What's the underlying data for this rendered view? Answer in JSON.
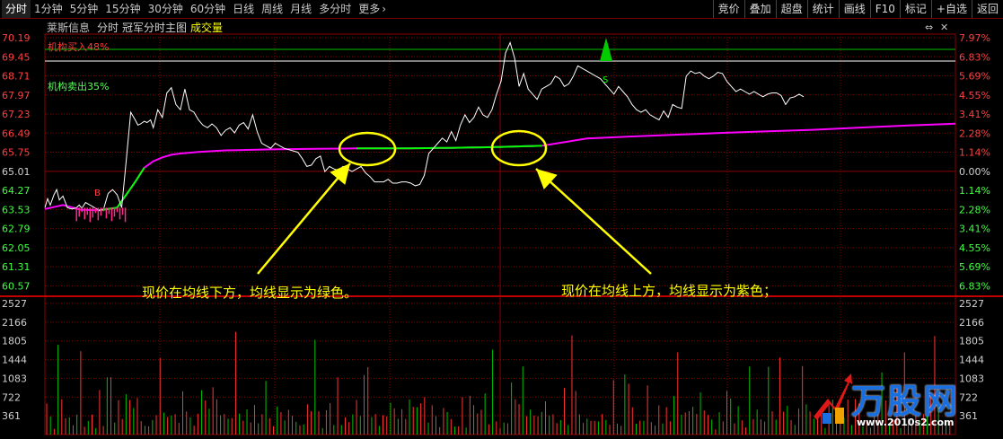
{
  "toolbar": {
    "tabs": [
      "分时",
      "1分钟",
      "5分钟",
      "15分钟",
      "30分钟",
      "60分钟",
      "日线",
      "周线",
      "月线",
      "多分时",
      "更多"
    ],
    "more_arrow": "›",
    "right_buttons": [
      "竞价",
      "叠加",
      "超盘",
      "统计",
      "画线",
      "F10",
      "标记",
      "+自选",
      "返回"
    ]
  },
  "info": {
    "stock_name": "莱斯信息",
    "mode": "分时",
    "indicator": "冠军分时主图",
    "volume_label": "成交量"
  },
  "indicators": {
    "buy": "机构买入48%",
    "sell": "机构卖出35%",
    "b_marker": "B",
    "s_marker": "S"
  },
  "annotations": {
    "left": "现价在均线下方，均线显示为绿色。",
    "right": "现价在均线上方，均线显示为紫色；"
  },
  "logo": {
    "brand": "万股网",
    "url": "www.2010s2.com"
  },
  "colors": {
    "background": "#000000",
    "grid": "#8b0000",
    "price_line": "#ffffff",
    "avg_above": "#ff00ff",
    "avg_below": "#00ff00",
    "up": "#ff3333",
    "down": "#00c000",
    "annotation": "#ffff00"
  },
  "chart_data": {
    "type": "line",
    "price_axis_labels": [
      "70.19",
      "69.45",
      "68.71",
      "67.97",
      "67.23",
      "66.49",
      "65.75",
      "65.01",
      "64.27",
      "63.53",
      "62.79",
      "62.05",
      "61.31",
      "60.57"
    ],
    "percent_axis_labels": [
      "7.97%",
      "6.83%",
      "5.69%",
      "4.55%",
      "3.41%",
      "2.28%",
      "1.14%",
      "0.00%",
      "1.14%",
      "2.28%",
      "3.41%",
      "4.55%",
      "5.69%",
      "6.83%"
    ],
    "volume_axis_labels": [
      "2527",
      "2166",
      "1805",
      "1444",
      "1083",
      "722",
      "361"
    ],
    "prev_close": 65.01,
    "ylim": [
      60.2,
      70.19
    ],
    "price_series": {
      "x": [
        0,
        3,
        6,
        10,
        13,
        16,
        20,
        25,
        30,
        35,
        38,
        41,
        45,
        50,
        55,
        60,
        65,
        70,
        75,
        80,
        85,
        90,
        95,
        100,
        103,
        106,
        110,
        113,
        117,
        120,
        125,
        130,
        135,
        140,
        145,
        150,
        155,
        160,
        165,
        170,
        175,
        180,
        185,
        190,
        195,
        200,
        205,
        210,
        215,
        220,
        225,
        230,
        235,
        240,
        245,
        250,
        255,
        260,
        265,
        270,
        275,
        280,
        285,
        290,
        295,
        300,
        305,
        310,
        315,
        320,
        325,
        330,
        335,
        340,
        345,
        350,
        355,
        360,
        365,
        370,
        375,
        380,
        385,
        390,
        395,
        400,
        405,
        410,
        415,
        420,
        425,
        430,
        435,
        440,
        445,
        450,
        455,
        460,
        465,
        470,
        475,
        480,
        485,
        490,
        495,
        500,
        505,
        510,
        515,
        520,
        525,
        530,
        535,
        540,
        545,
        550,
        555,
        560,
        565,
        570,
        575,
        580,
        585,
        590,
        595,
        600,
        605,
        610,
        615,
        620,
        625,
        630,
        635,
        640,
        645,
        650,
        655,
        660,
        665,
        670,
        675,
        680,
        685,
        690,
        695,
        700,
        705,
        710,
        715,
        720,
        725,
        730,
        735,
        740,
        745,
        750,
        755,
        760,
        765,
        770,
        775,
        780,
        785,
        790,
        795,
        800,
        805,
        810,
        815,
        820,
        825,
        830,
        835,
        840,
        845,
        850,
        855,
        860,
        865,
        870,
        875,
        880,
        885,
        890,
        895,
        900,
        905,
        910,
        915,
        920,
        925,
        930,
        935,
        940,
        945,
        950,
        955,
        960,
        965,
        970,
        975,
        980,
        985,
        990,
        995,
        1000,
        1005,
        1008
      ],
      "y": [
        63.6,
        63.95,
        63.7,
        64.1,
        64.3,
        63.9,
        64.05,
        63.6,
        63.55,
        63.6,
        63.7,
        63.58,
        63.8,
        63.7,
        63.6,
        63.5,
        63.55,
        64.15,
        64.3,
        64.1,
        63.6,
        65.4,
        67.3,
        67.0,
        66.8,
        66.85,
        66.95,
        66.9,
        67.0,
        66.7,
        67.4,
        67.1,
        68.05,
        68.25,
        67.6,
        67.4,
        68.2,
        67.4,
        67.3,
        67.0,
        66.8,
        66.7,
        66.85,
        66.7,
        66.4,
        66.6,
        66.7,
        66.5,
        66.8,
        66.9,
        66.65,
        67.2,
        66.55,
        66.1,
        66.0,
        65.9,
        66.1,
        66.0,
        65.9,
        65.85,
        65.8,
        65.75,
        65.5,
        65.2,
        65.25,
        65.5,
        65.6,
        65.0,
        65.2,
        65.1,
        65.05,
        65.2,
        65.1,
        65.0,
        65.1,
        65.2,
        64.95,
        64.8,
        64.6,
        64.6,
        64.6,
        64.7,
        64.55,
        64.55,
        64.6,
        64.6,
        64.55,
        64.45,
        64.5,
        64.85,
        65.7,
        65.9,
        66.1,
        66.3,
        66.15,
        66.55,
        66.2,
        66.8,
        67.2,
        66.9,
        67.1,
        67.5,
        67.2,
        67.1,
        67.4,
        68.0,
        68.5,
        69.6,
        70.0,
        69.4,
        68.3,
        68.8,
        68.2,
        68.0,
        67.8,
        68.2,
        68.3,
        68.4,
        68.7,
        68.6,
        68.3,
        68.4,
        68.7,
        69.1,
        69.0,
        68.9,
        68.8,
        68.7,
        68.6,
        68.4,
        68.2,
        68.0,
        68.3,
        68.1,
        67.9,
        67.6,
        67.4,
        67.3,
        67.4,
        67.2,
        67.1,
        67.0,
        67.35,
        67.1,
        67.6,
        67.5,
        67.45,
        68.7,
        68.9,
        68.8,
        68.85,
        68.7,
        68.6,
        68.7,
        68.85,
        68.8,
        68.5,
        68.3,
        68.1,
        68.2,
        68.1,
        68.0,
        68.1,
        68.0,
        67.9,
        68.0,
        68.05,
        68.05,
        67.95,
        67.6,
        67.85,
        67.9,
        68.0,
        67.9
      ]
    },
    "avg_series": {
      "x": [
        0,
        20,
        40,
        60,
        80,
        100,
        110,
        120,
        130,
        140,
        150,
        170,
        200,
        250,
        300,
        350,
        400,
        450,
        500,
        550,
        600,
        650,
        700,
        750,
        800,
        850,
        900,
        950,
        1008
      ],
      "y": [
        63.55,
        63.7,
        63.52,
        63.5,
        63.6,
        64.6,
        65.15,
        65.4,
        65.55,
        65.65,
        65.7,
        65.76,
        65.82,
        65.86,
        65.88,
        65.9,
        65.9,
        65.92,
        65.95,
        66.0,
        66.28,
        66.36,
        66.43,
        66.5,
        66.56,
        66.62,
        66.7,
        66.78,
        66.86
      ]
    },
    "green_segments": [
      [
        345,
        550
      ],
      [
        60,
        110
      ]
    ],
    "volume": {
      "max": 2527,
      "values_sample": [
        1500,
        900,
        1100,
        600,
        1300,
        500,
        800,
        450,
        700,
        1000,
        300,
        600,
        400,
        900,
        200,
        700,
        1300,
        1200,
        800,
        2300,
        2100,
        1700,
        1900,
        2000,
        1600,
        1200,
        1400,
        900,
        700,
        1000,
        800,
        600,
        500,
        900,
        400,
        300,
        700,
        600,
        500,
        800,
        400,
        300,
        600,
        500,
        400,
        300,
        500,
        700,
        600,
        400,
        1100,
        300,
        400,
        700,
        800,
        500,
        300,
        200,
        400,
        600,
        500,
        900,
        300,
        400,
        1600,
        1900,
        2200,
        1300,
        1000,
        700,
        600,
        500,
        400,
        300,
        600,
        900,
        800,
        700,
        500,
        400,
        300,
        600,
        500,
        400,
        300,
        500,
        400,
        300,
        600,
        500,
        400,
        300,
        200,
        500,
        400,
        300,
        400,
        300,
        200,
        300
      ]
    }
  }
}
